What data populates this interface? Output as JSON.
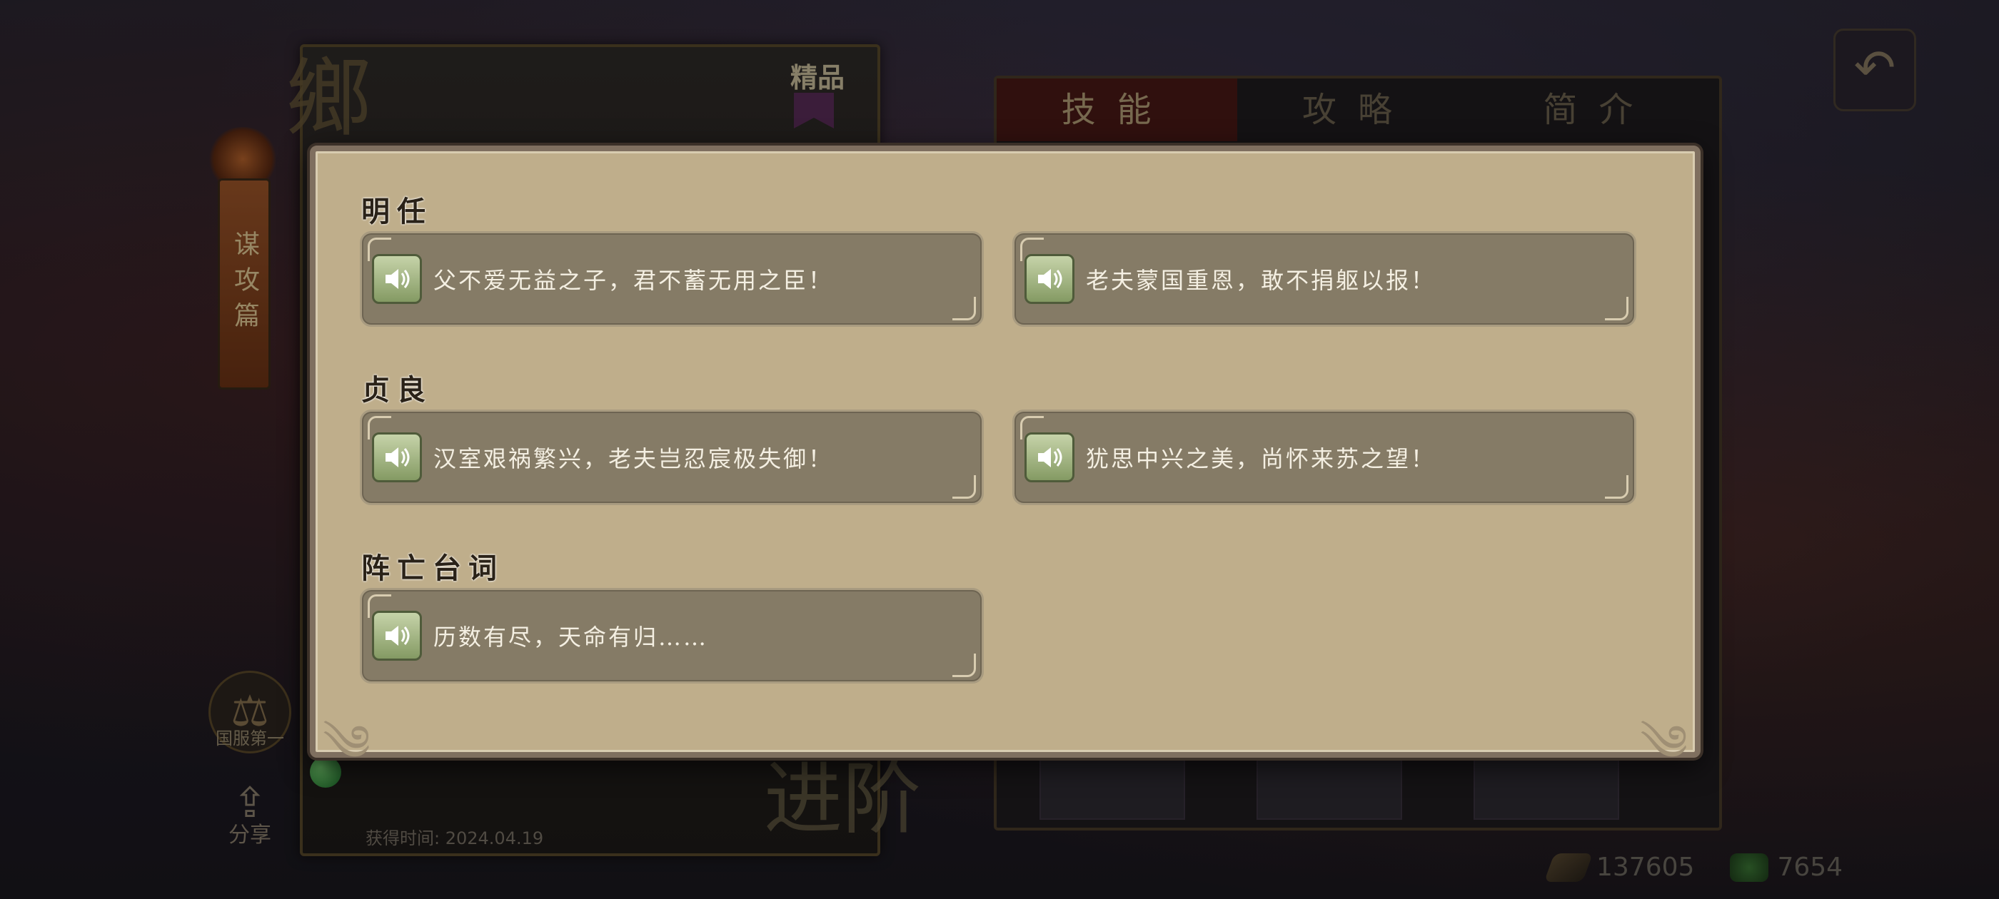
{
  "background": {
    "premium_tag": "精品",
    "side_tab_label": "谋攻篇",
    "emblem_label": "国服第一",
    "share_label": "分享",
    "acquire_time": "获得时间: 2024.04.19",
    "advance_label": "进阶",
    "skill_tabs": [
      "技能",
      "攻略",
      "简介"
    ],
    "resources": [
      {
        "icon": "feather-icon",
        "value": "137605"
      },
      {
        "icon": "jade-icon",
        "value": "7654"
      }
    ]
  },
  "modal": {
    "sections": [
      {
        "title": "明任",
        "lines": [
          "父不爱无益之子，君不蓄无用之臣！",
          "老夫蒙国重恩，敢不捐躯以报！"
        ]
      },
      {
        "title": "贞良",
        "lines": [
          "汉室艰祸繁兴，老夫岂忍宸极失御！",
          "犹思中兴之美，尚怀来苏之望！"
        ]
      },
      {
        "title": "阵亡台词",
        "lines": [
          "历数有尽，天命有归……"
        ]
      }
    ]
  },
  "colors": {
    "modal_bg": "#bfae8b",
    "line_box_bg": "#857b66",
    "speaker_green": "#a9bb86"
  }
}
